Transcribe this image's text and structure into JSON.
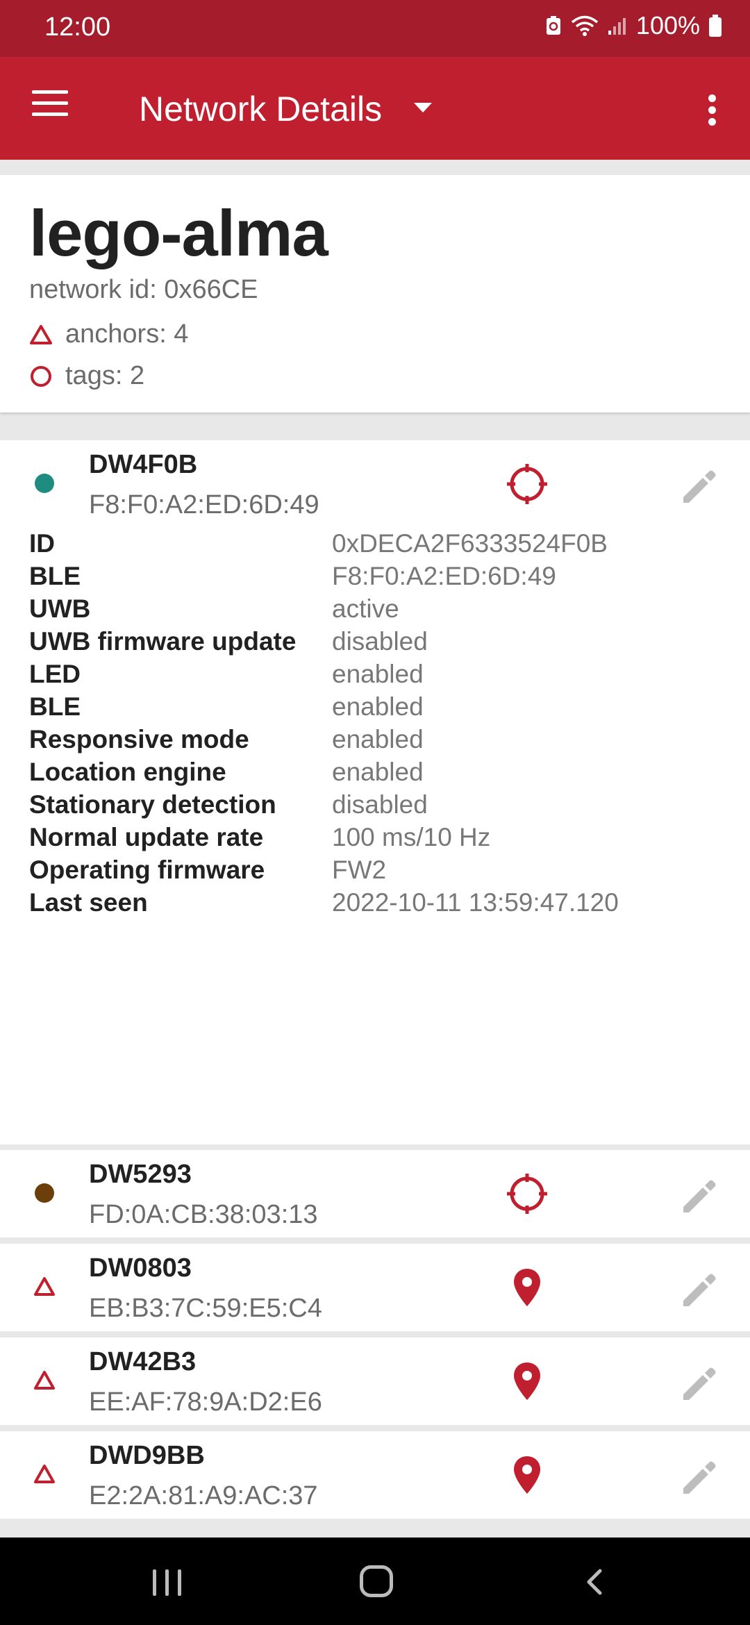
{
  "status_bar": {
    "time": "12:00",
    "battery": "100%"
  },
  "app_bar": {
    "title": "Network Details"
  },
  "network": {
    "name": "lego-alma",
    "id_text": "network id: 0x66CE",
    "anchors_text": "anchors: 4",
    "tags_text": "tags: 2"
  },
  "expanded_device": {
    "name": "DW4F0B",
    "mac": "F8:F0:A2:ED:6D:49",
    "status_color": "#1f8c80",
    "properties": [
      {
        "label": "ID",
        "value": "0xDECA2F6333524F0B"
      },
      {
        "label": "BLE",
        "value": "F8:F0:A2:ED:6D:49"
      },
      {
        "label": "UWB",
        "value": "active"
      },
      {
        "label": "UWB firmware update",
        "value": "disabled"
      },
      {
        "label": "LED",
        "value": "enabled"
      },
      {
        "label": "BLE",
        "value": "enabled"
      },
      {
        "label": "Responsive mode",
        "value": "enabled"
      },
      {
        "label": "Location engine",
        "value": "enabled"
      },
      {
        "label": "Stationary detection",
        "value": "disabled"
      },
      {
        "label": "Normal update rate",
        "value": "100 ms/10 Hz"
      },
      {
        "label": "Operating firmware",
        "value": "FW2"
      },
      {
        "label": "Last seen",
        "value": "2022-10-11 13:59:47.120"
      }
    ]
  },
  "devices": [
    {
      "name": "DW5293",
      "mac": "FD:0A:CB:38:03:13",
      "kind": "tag",
      "status_color": "#6b3e0a"
    },
    {
      "name": "DW0803",
      "mac": "EB:B3:7C:59:E5:C4",
      "kind": "anchor"
    },
    {
      "name": "DW42B3",
      "mac": "EE:AF:78:9A:D2:E6",
      "kind": "anchor"
    },
    {
      "name": "DWD9BB",
      "mac": "E2:2A:81:A9:AC:37",
      "kind": "anchor"
    }
  ],
  "colors": {
    "accent": "#c01f2f",
    "status_bar": "#a51d2d"
  },
  "icons": {
    "menu": "menu-icon",
    "dropdown": "caret-down-icon",
    "overflow": "more-vert-icon",
    "anchor": "triangle-outline-icon",
    "tag": "circle-outline-icon",
    "locate_tag": "crosshair-icon",
    "locate_anchor": "map-pin-icon",
    "edit": "pencil-icon"
  }
}
